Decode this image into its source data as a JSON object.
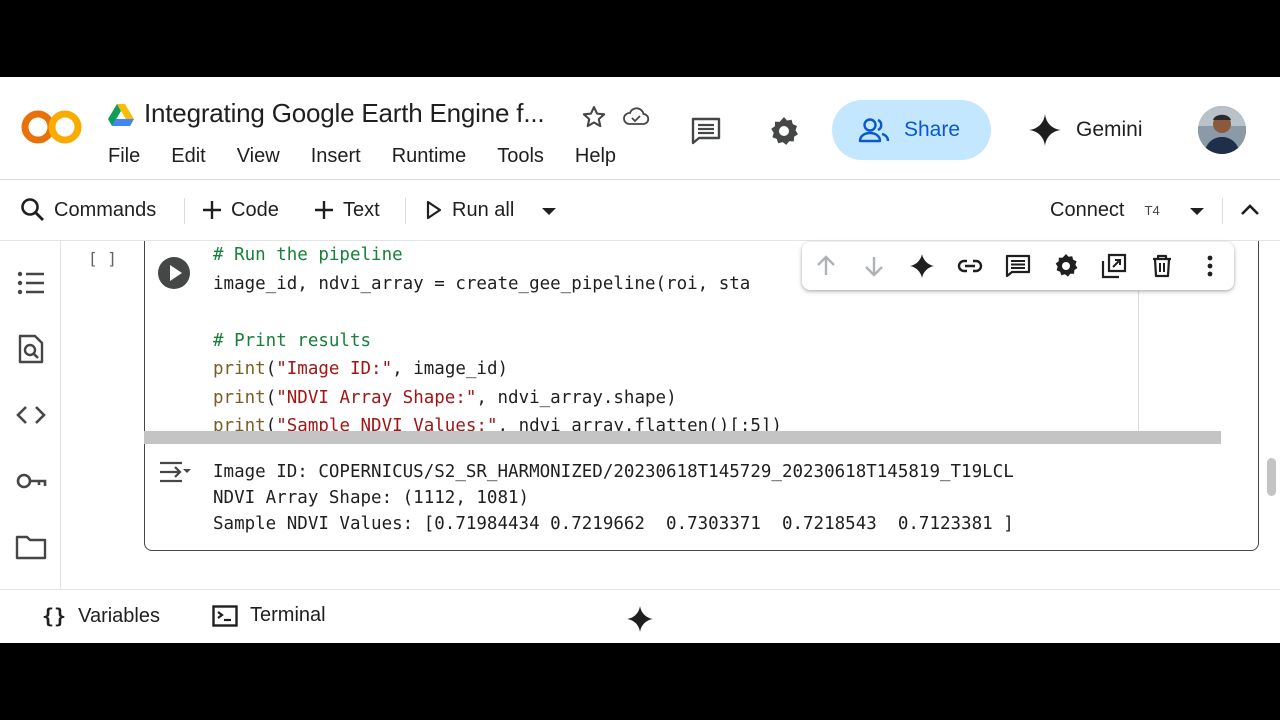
{
  "header": {
    "title": "Integrating Google Earth Engine f...",
    "menu": [
      "File",
      "Edit",
      "View",
      "Insert",
      "Runtime",
      "Tools",
      "Help"
    ],
    "share_label": "Share",
    "gemini_label": "Gemini",
    "icons": [
      "colab-logo",
      "drive-icon",
      "star-icon",
      "cloud-saved-icon",
      "comment-icon",
      "gear-icon",
      "share-people-icon",
      "gemini-sparkle-icon",
      "avatar"
    ]
  },
  "toolbar": {
    "commands_label": "Commands",
    "code_label": "Code",
    "text_label": "Text",
    "run_all_label": "Run all",
    "connect_label": "Connect",
    "runtime_badge": "T4"
  },
  "rail": {
    "icons": [
      "toc-icon",
      "find-icon",
      "code-snippets-icon",
      "secrets-key-icon",
      "folder-icon"
    ]
  },
  "cell": {
    "execution_count": "[ ]",
    "code_lines": [
      {
        "type": "comment",
        "text": "# Run the pipeline"
      },
      {
        "type": "code",
        "text": "image_id, ndvi_array = create_gee_pipeline(roi, sta"
      },
      {
        "type": "blank",
        "text": ""
      },
      {
        "type": "comment",
        "text": "# Print results"
      },
      {
        "type": "print",
        "fn": "print",
        "str": "\"Image ID:\"",
        "rest": ", image_id)"
      },
      {
        "type": "print",
        "fn": "print",
        "str": "\"NDVI Array Shape:\"",
        "rest": ", ndvi_array.shape)"
      },
      {
        "type": "print",
        "fn": "print",
        "str": "\"Sample NDVI Values:\"",
        "rest": ", ndvi_array.flatten()[:5])"
      }
    ],
    "output_lines": [
      "Image ID: COPERNICUS/S2_SR_HARMONIZED/20230618T145729_20230618T145819_T19LCL",
      "NDVI Array Shape: (1112, 1081)",
      "Sample NDVI Values: [0.71984434 0.7219662  0.7303371  0.7218543  0.7123381 ]"
    ],
    "cell_toolbar_icons": [
      "move-up-icon",
      "move-down-icon",
      "gemini-icon",
      "link-icon",
      "comment-icon",
      "settings-icon",
      "mirror-cell-icon",
      "delete-icon",
      "more-vert-icon"
    ]
  },
  "bottom": {
    "variables_label": "Variables",
    "terminal_label": "Terminal"
  },
  "colors": {
    "accent_blue": "#0b57d0",
    "share_bg": "#c2e7ff",
    "logo_orange": "#f9ab00",
    "logo_dark_orange": "#e8710a"
  }
}
